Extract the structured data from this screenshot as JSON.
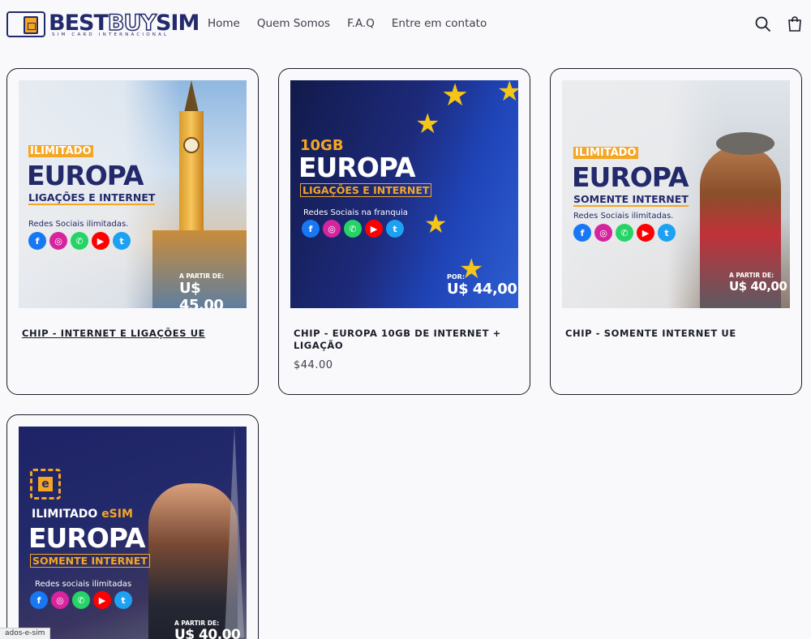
{
  "header": {
    "logo": {
      "brand": "BESTBUYSIM",
      "brand_a": "BEST",
      "brand_b": "BUY",
      "brand_c": "SIM",
      "tagline": "SIM CARD INTERNACIONAL"
    },
    "nav": [
      {
        "label": "Home"
      },
      {
        "label": "Quem Somos"
      },
      {
        "label": "F.A.Q"
      },
      {
        "label": "Entre em contato"
      }
    ],
    "icons": {
      "search": "search-icon",
      "cart": "cart-icon"
    }
  },
  "products": [
    {
      "title": "CHIP - INTERNET E LIGAÇÕES UE",
      "price": "",
      "image": {
        "tag": "ILIMITADO",
        "region": "EUROPA",
        "subtitle": "LIGAÇÕES E INTERNET",
        "social_text": "Redes Sociais ilimitadas.",
        "price_label": "A PARTIR DE:",
        "price_value": "U$ 45,00"
      }
    },
    {
      "title": "CHIP - EUROPA 10GB DE INTERNET + LIGAÇÃO",
      "price": "$44.00",
      "image": {
        "tag": "10GB",
        "region": "EUROPA",
        "subtitle": "LIGAÇÕES E INTERNET",
        "social_text": "Redes Sociais  na franquia",
        "price_label": "POR:",
        "price_value": "U$ 44,00"
      }
    },
    {
      "title": "CHIP - SOMENTE INTERNET UE",
      "price": "",
      "image": {
        "tag": "ILIMITADO",
        "region": "EUROPA",
        "subtitle": "SOMENTE INTERNET",
        "social_text": "Redes Sociais  ilimitadas.",
        "price_label": "A PARTIR DE:",
        "price_value": "U$ 40,00"
      }
    },
    {
      "title": "",
      "price": "",
      "image": {
        "tag": "ILIMITADO",
        "tag2": "eSIM",
        "region": "EUROPA",
        "subtitle": "SOMENTE INTERNET",
        "social_text": "Redes sociais ilimitadas",
        "price_label": "A PARTIR DE:",
        "price_value": "U$ 40,00"
      }
    }
  ],
  "status_bar": {
    "text": "ados-e-sim"
  },
  "colors": {
    "brand_navy": "#232a6b",
    "accent_orange": "#f5a623",
    "card_border": "#1a1d2b"
  }
}
